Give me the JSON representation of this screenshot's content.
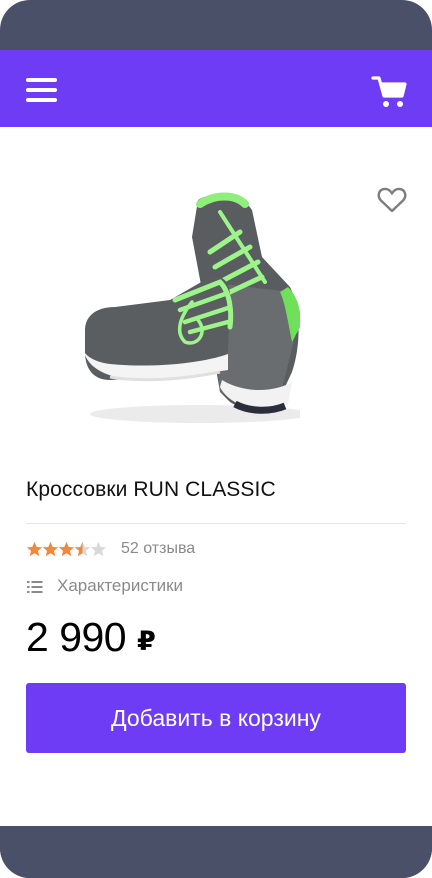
{
  "header": {
    "menu_icon": "hamburger-menu-icon",
    "cart_icon": "shopping-cart-icon",
    "accent_color": "#6e3cf5"
  },
  "product": {
    "image_icon": "running-shoes-image",
    "favorite_icon": "heart-outline-icon",
    "title": "Кроссовки RUN CLASSIC",
    "rating": 3.5,
    "rating_max": 5,
    "reviews_label": "52 отзыва",
    "specs_icon": "list-icon",
    "specs_label": "Характеристики",
    "price": "2 990",
    "currency": "₽",
    "add_to_cart_label": "Добавить в корзину"
  },
  "colors": {
    "star_filled": "#f0883e",
    "star_empty": "#d9d9d9",
    "frame": "#4b5069"
  }
}
